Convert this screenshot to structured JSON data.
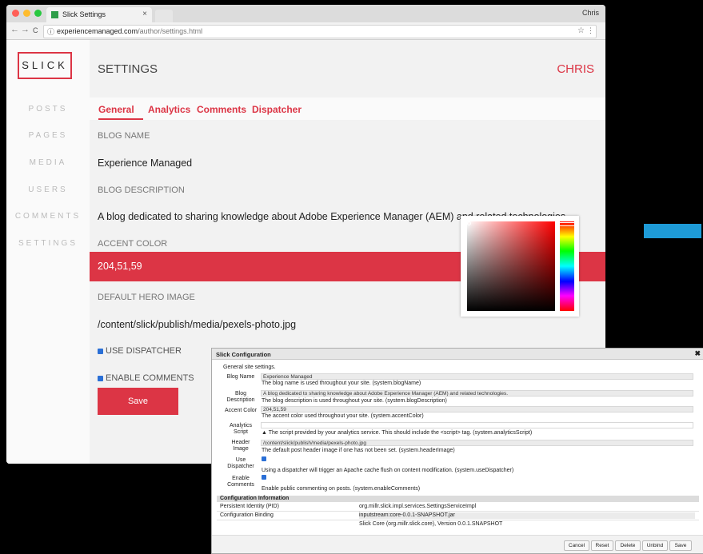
{
  "browser": {
    "tab_title": "Slick Settings",
    "tab_close": "×",
    "profile": "Chris",
    "url_host": "experiencemanaged.com",
    "url_path": "/author/settings.html",
    "back_icon": "←",
    "forward_icon": "→",
    "reload_icon": "C",
    "info_icon": "ⓘ",
    "star_icon": "☆",
    "menu_icon": "⋮"
  },
  "app": {
    "logo": "SLICK",
    "nav": [
      "POSTS",
      "PAGES",
      "MEDIA",
      "USERS",
      "COMMENTS",
      "SETTINGS"
    ],
    "page_title": "SETTINGS",
    "user": "CHRIS",
    "tabs": [
      "General",
      "Analytics",
      "Comments",
      "Dispatcher"
    ],
    "fields": {
      "blog_name_label": "BLOG NAME",
      "blog_name": "Experience Managed",
      "blog_desc_label": "BLOG DESCRIPTION",
      "blog_desc": "A blog dedicated to sharing knowledge about Adobe Experience Manager (AEM) and related technologies.",
      "accent_label": "ACCENT COLOR",
      "accent": "204,51,59",
      "hero_label": "DEFAULT HERO IMAGE",
      "hero": "/content/slick/publish/media/pexels-photo.jpg",
      "use_dispatcher": "USE DISPATCHER",
      "enable_comments": "ENABLE COMMENTS"
    },
    "save": "Save",
    "accent_color": "#dc3545"
  },
  "dialog": {
    "title": "Slick Configuration",
    "close": "✖",
    "intro": "General site settings.",
    "blog_name_label": "Blog Name",
    "blog_name_value": "Experience Managed",
    "blog_name_desc": "The blog name is used throughout your site. (system.blogName)",
    "blog_desc_label": "Blog Description",
    "blog_desc_value": "A blog dedicated to sharing knowledge about Adobe Experience Manager (AEM) and related technologies.",
    "blog_desc_desc": "The blog description is used throughout your site. (system.blogDescription)",
    "accent_label": "Accent Color",
    "accent_value": "204,51,59",
    "accent_desc": "The accent color used throughout your site. (system.accentColor)",
    "analytics_label": "Analytics Script",
    "analytics_desc": "The script provided by your analytics service. This should include the <script> tag. (system.analyticsScript)",
    "header_label": "Header Image",
    "header_value": "/content/slick/publish/media/pexels-photo.jpg",
    "header_desc": "The default post header image if one has not been set. (system.headerImage)",
    "dispatcher_label": "Use Dispatcher",
    "dispatcher_desc": "Using a dispatcher will trigger an Apache cache flush on content modification. (system.useDispatcher)",
    "comments_label": "Enable Comments",
    "comments_desc": "Enable public commenting on posts. (system.enableComments)",
    "config_info": "Configuration Information",
    "pid_label": "Persistent Identity (PID)",
    "pid_value": "org.millr.slick.impl.services.SettingsServiceImpl",
    "binding_label": "Configuration Binding",
    "binding_value": "inputstream:core-0.0.1-SNAPSHOT.jar",
    "bundle_value": "Slick Core (org.millr.slick.core), Version 0.0.1.SNAPSHOT",
    "buttons": [
      "Cancel",
      "Reset",
      "Delete",
      "Unbind",
      "Save"
    ]
  }
}
